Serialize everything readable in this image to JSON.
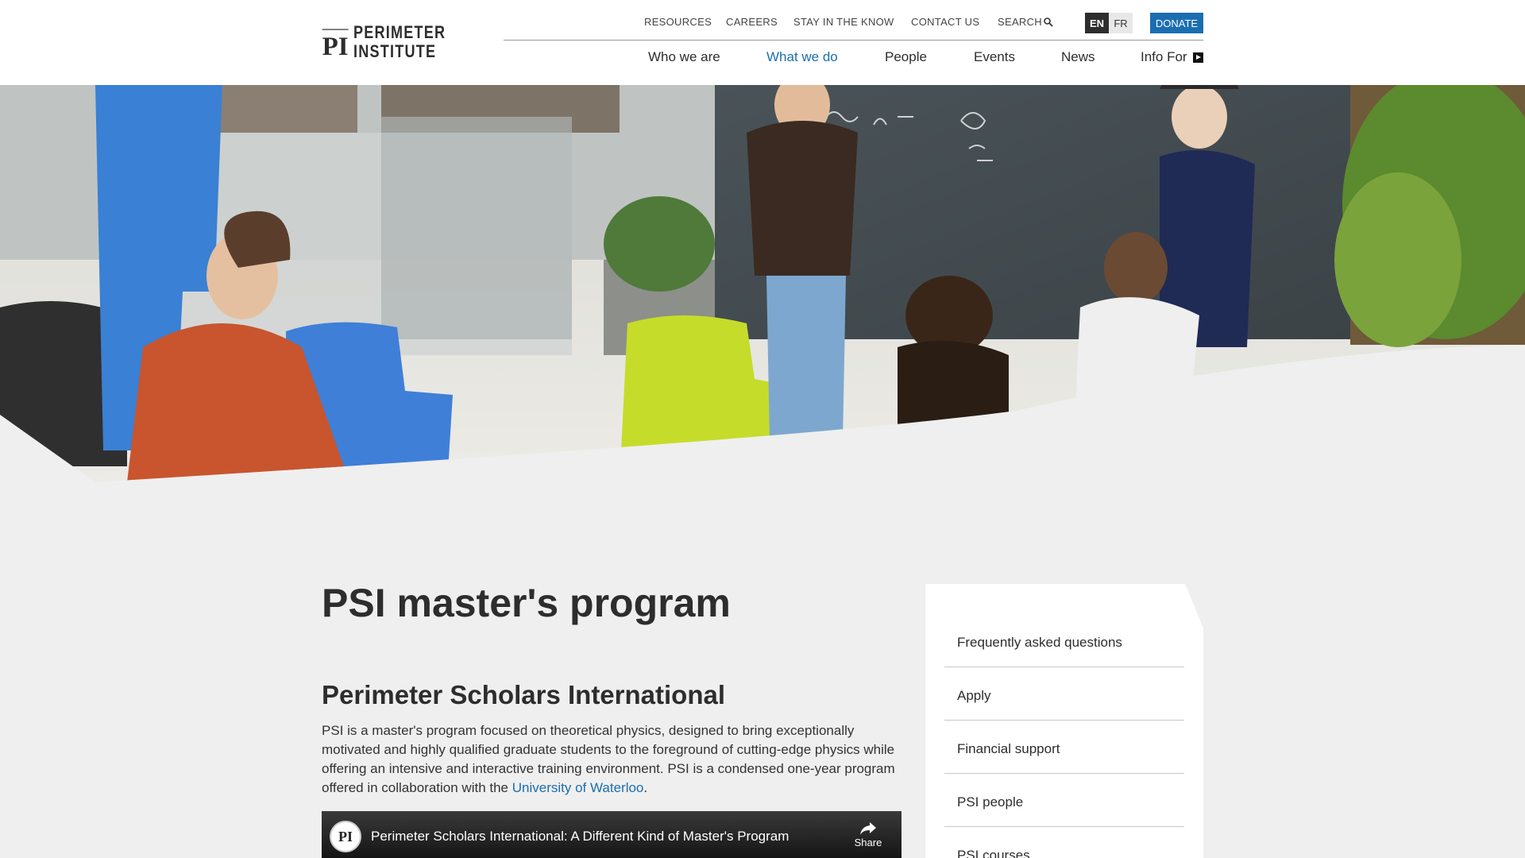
{
  "header": {
    "logo": {
      "line1": "PERIMETER",
      "line2": "INSTITUTE"
    },
    "utility": {
      "resources": "RESOURCES",
      "careers": "CAREERS",
      "stay": "STAY IN THE KNOW",
      "contact": "CONTACT US",
      "search": "SEARCH"
    },
    "lang": {
      "en": "EN",
      "fr": "FR"
    },
    "donate": "DONATE"
  },
  "nav": {
    "who": "Who we are",
    "what": "What we do",
    "people": "People",
    "events": "Events",
    "news": "News",
    "info": "Info For"
  },
  "main": {
    "title": "PSI master's program",
    "subtitle": "Perimeter Scholars International",
    "intro_text": "PSI is a master's program focused on theoretical physics, designed to bring exceptionally motivated and highly qualified graduate students to the foreground of cutting-edge physics while offering an intensive and interactive training environment. PSI is a condensed one-year program offered in collaboration with the ",
    "intro_link": "University of Waterloo",
    "intro_end": "."
  },
  "video": {
    "title": "Perimeter Scholars International: A Different Kind of Master's Program",
    "share": "Share",
    "avatar_text": "PI"
  },
  "sidebar": {
    "items": [
      {
        "label": "Frequently asked questions"
      },
      {
        "label": "Apply"
      },
      {
        "label": "Financial support"
      },
      {
        "label": "PSI people"
      },
      {
        "label": "PSI courses"
      }
    ]
  },
  "colors": {
    "accent": "#1a6eb0",
    "text": "#2d2d2d",
    "background": "#efefef"
  }
}
